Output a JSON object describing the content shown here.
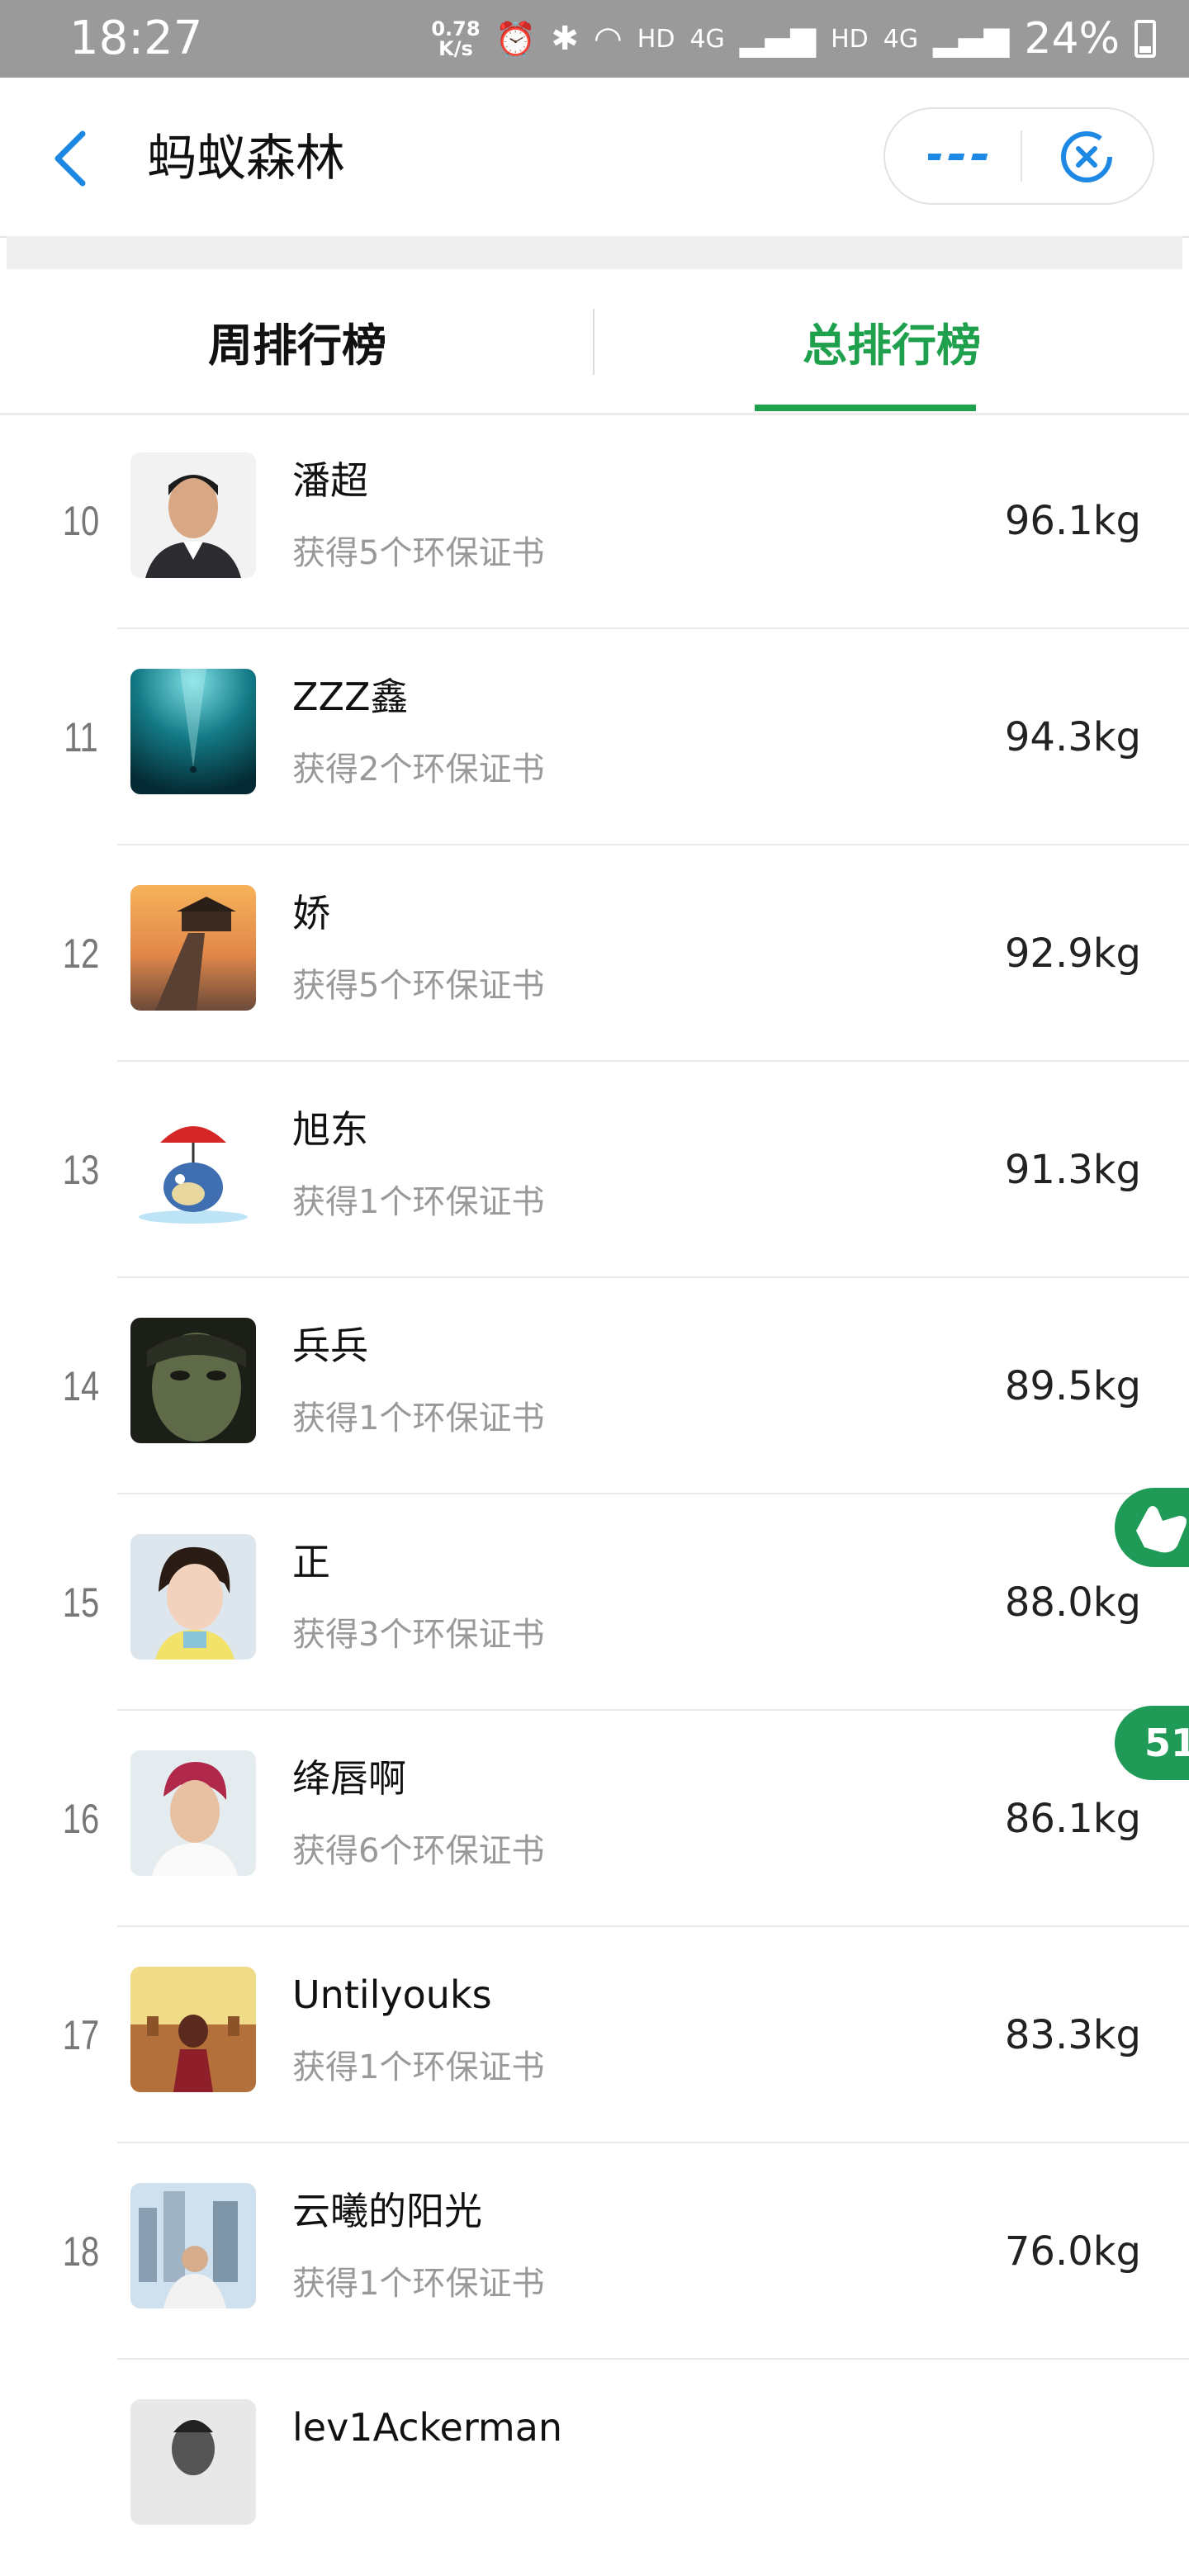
{
  "status_bar": {
    "time": "18:27",
    "net_speed_value": "0.78",
    "net_speed_unit": "K/s",
    "hd1": "HD",
    "net1": "4G",
    "hd2": "HD",
    "net2": "4G",
    "battery_percent": "24%"
  },
  "header": {
    "title": "蚂蚁森林"
  },
  "tabs": [
    {
      "label": "周排行榜",
      "active": false
    },
    {
      "label": "总排行榜",
      "active": true
    }
  ],
  "accent_color": "#1fa04c",
  "rankings": [
    {
      "rank": "10",
      "name": "潘超",
      "certificates": "获得5个环保证书",
      "weight": "96.1kg",
      "avatar": "avatar-person-icon"
    },
    {
      "rank": "11",
      "name": "ZZZ鑫",
      "certificates": "获得2个环保证书",
      "weight": "94.3kg",
      "avatar": "avatar-underwater-icon"
    },
    {
      "rank": "12",
      "name": "娇",
      "certificates": "获得5个环保证书",
      "weight": "92.9kg",
      "avatar": "avatar-pier-sunset-icon"
    },
    {
      "rank": "13",
      "name": "旭东",
      "certificates": "获得1个环保证书",
      "weight": "91.3kg",
      "avatar": "avatar-cartoon-umbrella-icon"
    },
    {
      "rank": "14",
      "name": "兵兵",
      "certificates": "获得1个环保证书",
      "weight": "89.5kg",
      "avatar": "avatar-painted-face-icon"
    },
    {
      "rank": "15",
      "name": "正",
      "certificates": "获得3个环保证书",
      "weight": "88.0kg",
      "avatar": "avatar-girl-icon"
    },
    {
      "rank": "16",
      "name": "绛唇啊",
      "certificates": "获得6个环保证书",
      "weight": "86.1kg",
      "avatar": "avatar-red-hair-icon"
    },
    {
      "rank": "17",
      "name": "Untilyouks",
      "certificates": "获得1个环保证书",
      "weight": "83.3kg",
      "avatar": "avatar-temple-icon"
    },
    {
      "rank": "18",
      "name": "云曦的阳光",
      "certificates": "获得1个环保证书",
      "weight": "76.0kg",
      "avatar": "avatar-city-person-icon"
    },
    {
      "rank": "",
      "name": "lev1Ackerman",
      "certificates": "",
      "weight": "",
      "avatar": "avatar-bw-portrait-icon"
    }
  ],
  "floating_badges": {
    "number_badge": "51"
  }
}
